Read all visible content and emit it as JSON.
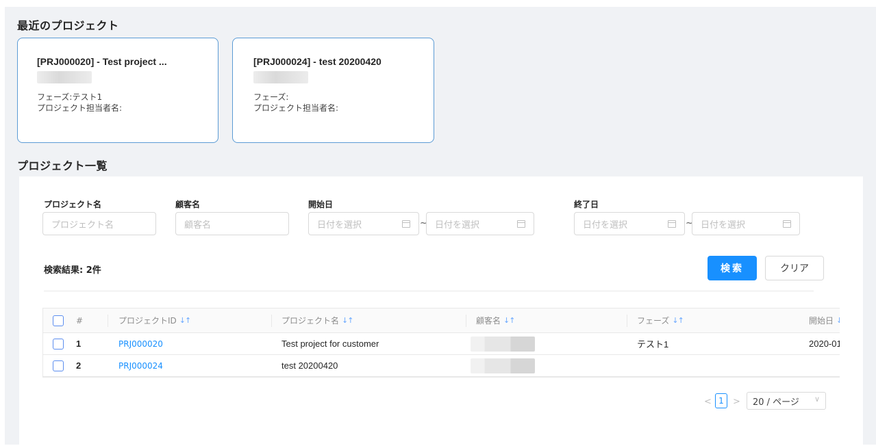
{
  "recent": {
    "title": "最近のプロジェクト",
    "cards": [
      {
        "title": "[PRJ000020] - Test project ...",
        "phase": "フェーズ:テスト1",
        "manager": "プロジェクト担当者名:"
      },
      {
        "title": "[PRJ000024] - test 20200420",
        "phase": "フェーズ:",
        "manager": "プロジェクト担当者名:"
      }
    ]
  },
  "list": {
    "title": "プロジェクト一覧",
    "filters": {
      "project_name_label": "プロジェクト名",
      "project_name_placeholder": "プロジェクト名",
      "customer_label": "顧客名",
      "customer_placeholder": "顧客名",
      "start_label": "開始日",
      "end_label": "終了日",
      "date_placeholder": "日付を選択",
      "range_separator": "~"
    },
    "result_count": "検索結果: 2件",
    "search_label": "検索",
    "clear_label": "クリア",
    "table": {
      "headers": {
        "num": "#",
        "project_id": "プロジェクトID",
        "project_name": "プロジェクト名",
        "customer": "顧客名",
        "phase": "フェーズ",
        "start_date": "開始日"
      },
      "sort_glyph": "↓↑",
      "rows": [
        {
          "num": "1",
          "project_id": "PRJ000020",
          "project_name": "Test project for customer",
          "phase": "テスト1",
          "start_date": "2020-01-"
        },
        {
          "num": "2",
          "project_id": "PRJ000024",
          "project_name": "test 20200420",
          "phase": "",
          "start_date": ""
        }
      ]
    },
    "pagination": {
      "prev": "<",
      "current_page": "1",
      "next": ">",
      "page_size": "20 / ページ"
    }
  },
  "colors": {
    "primary": "#1890ff",
    "card_border": "#5b9bd5",
    "background": "#f0f2f5"
  },
  "icons": [
    "calendar-icon",
    "sort-icon",
    "chevron-down-icon"
  ]
}
